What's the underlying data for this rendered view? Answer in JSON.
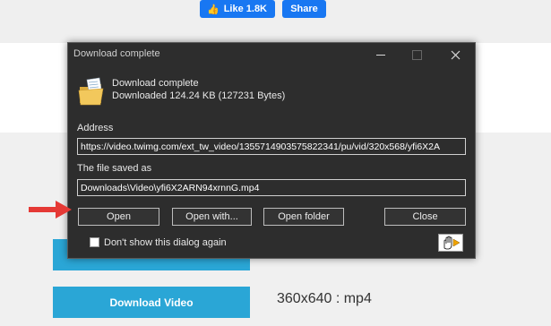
{
  "page": {
    "fb_like": "Like 1.8K",
    "fb_share": "Share",
    "download_button": "Download Video",
    "format": "360x640 : mp4"
  },
  "dialog": {
    "title": "Download complete",
    "status": "Download complete",
    "detail": "Downloaded 124.24  KB (127231 Bytes)",
    "address_label": "Address",
    "address_value": "https://video.twimg.com/ext_tw_video/1355714903575822341/pu/vid/320x568/yfi6X2A",
    "file_label": "The file saved as",
    "file_value": "Downloads\\Video\\yfi6X2ARN94xrnnG.mp4",
    "buttons": {
      "open": "Open",
      "open_with": "Open with...",
      "open_folder": "Open folder",
      "close": "Close"
    },
    "checkbox_label": "Don't show this dialog again",
    "checkbox_checked": false
  },
  "colors": {
    "dialog_bg": "#2d2d2d",
    "download_btn": "#2aa6d6",
    "facebook": "#1877f2",
    "arrow": "#e53935"
  }
}
